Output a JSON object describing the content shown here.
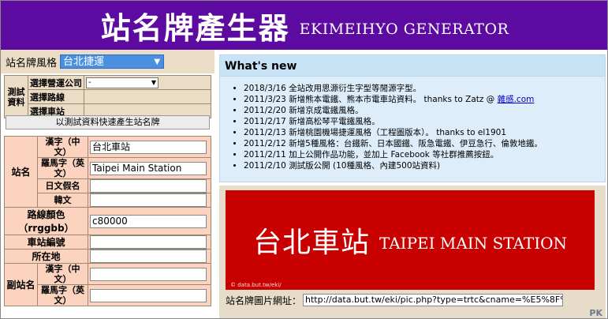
{
  "header": {
    "title_zh": "站名牌產生器",
    "title_en": "EKIMEIHYO GENERATOR"
  },
  "style": {
    "label": "站名牌風格",
    "selected": "台北捷運"
  },
  "test": {
    "group_label": "測試資料",
    "company_label": "選擇營運公司",
    "company_value": "-",
    "line_label": "選擇路線",
    "station_label": "選擇車站",
    "fill_button": "以測試資料快速產生站名牌"
  },
  "form": {
    "station_group": "站名",
    "kanji_label": "漢字（中文）",
    "kanji_value": "台北車站",
    "romaji_label": "羅馬字（英文）",
    "romaji_value": "Taipei Main Station",
    "kana_label": "日文假名",
    "korean_label": "韓文",
    "color_label": "路線顏色（rrggbb）",
    "color_value": "c80000",
    "number_label": "車站編號",
    "location_label": "所在地",
    "sub_group": "副站名",
    "sub_kanji_label": "漢字（中文）",
    "sub_romaji_label": "羅馬字（英文）"
  },
  "news": {
    "title": "What's new",
    "items": [
      {
        "date": "2018/3/16",
        "text": "全站改用思源衍生字型等閒源字型。"
      },
      {
        "date": "2011/3/23",
        "text": "新增熊本電鐵、熊本市電車站資料。 thanks to Zatz @ ",
        "link": "雜感.com"
      },
      {
        "date": "2011/2/20",
        "text": "新增京成電鐵風格。"
      },
      {
        "date": "2011/2/17",
        "text": "新增高松琴平電鐵風格。"
      },
      {
        "date": "2011/2/13",
        "text": "新增桃園機場捷運風格（工程圖版本）。 thanks to el1901"
      },
      {
        "date": "2011/2/12",
        "text": "新增5種風格：台鐵新、日本國鐵、阪急電鐵、伊豆急行、倫敦地鐵。"
      },
      {
        "date": "2011/2/11",
        "text": "加上公開作品功能，並加上 Facebook 等社群推薦按鈕。"
      },
      {
        "date": "2011/2/10",
        "text": "測試版公開 (10種風格、內建500站資料)"
      }
    ]
  },
  "preview": {
    "sign_zh": "台北車站",
    "sign_en": "TAIPEI MAIN STATION",
    "sign_color": "#c80000",
    "watermark": "© data.but.tw/eki/",
    "url_label": "站名牌圖片網址：",
    "url_value": "http://data.but.tw/eki/pic.php?type=trtc&cname=%E5%8F%B0",
    "badge": "PK"
  }
}
